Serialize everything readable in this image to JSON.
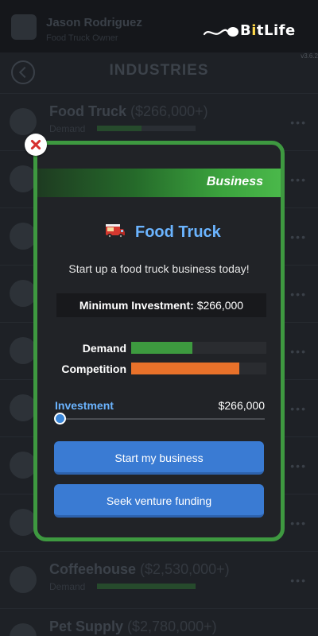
{
  "app": {
    "logo_text": "BitLife",
    "version": "v3.6.2"
  },
  "topbar": {
    "player_name": "Jason Rodriguez",
    "player_sub": "Food Truck Owner"
  },
  "header": {
    "title": "INDUSTRIES"
  },
  "industries": [
    {
      "name": "Food Truck",
      "price": "($266,000+)",
      "demand_label": "Demand",
      "demand": 0.45
    },
    {
      "name": "",
      "price": "",
      "demand_label": "",
      "demand": 0
    },
    {
      "name": "",
      "price": "",
      "demand_label": "",
      "demand": 0
    },
    {
      "name": "",
      "price": "",
      "demand_label": "",
      "demand": 0
    },
    {
      "name": "",
      "price": "",
      "demand_label": "",
      "demand": 0
    },
    {
      "name": "",
      "price": "",
      "demand_label": "",
      "demand": 0
    },
    {
      "name": "",
      "price": "",
      "demand_label": "",
      "demand": 0
    },
    {
      "name": "Coffeehouse",
      "price": "($2,530,000+)",
      "demand_label": "Demand",
      "demand": 1.0
    },
    {
      "name": "Pet Supply",
      "price": "($2,780,000+)",
      "demand_label": "",
      "demand": 0
    }
  ],
  "modal": {
    "banner": "Business",
    "title": "Food Truck",
    "description": "Start up a food truck business today!",
    "min_investment_label": "Minimum Investment:",
    "min_investment_value": "$266,000",
    "stats": {
      "demand_label": "Demand",
      "demand_level": 0.45,
      "competition_label": "Competition",
      "competition_level": 0.8
    },
    "investment_label": "Investment",
    "investment_value": "$266,000",
    "slider_level": 0.0,
    "start_button": "Start my business",
    "funding_button": "Seek venture funding"
  },
  "colors": {
    "accent_blue": "#6bb4ff",
    "button_blue": "#3a7bd3",
    "modal_border": "#3e9940",
    "demand_bar": "#3d9a3f",
    "competition_bar": "#e8712a",
    "close_x": "#d6312f"
  },
  "icons": [
    "close-icon",
    "back-arrow-icon",
    "food-truck-icon",
    "more-dots-icon"
  ]
}
